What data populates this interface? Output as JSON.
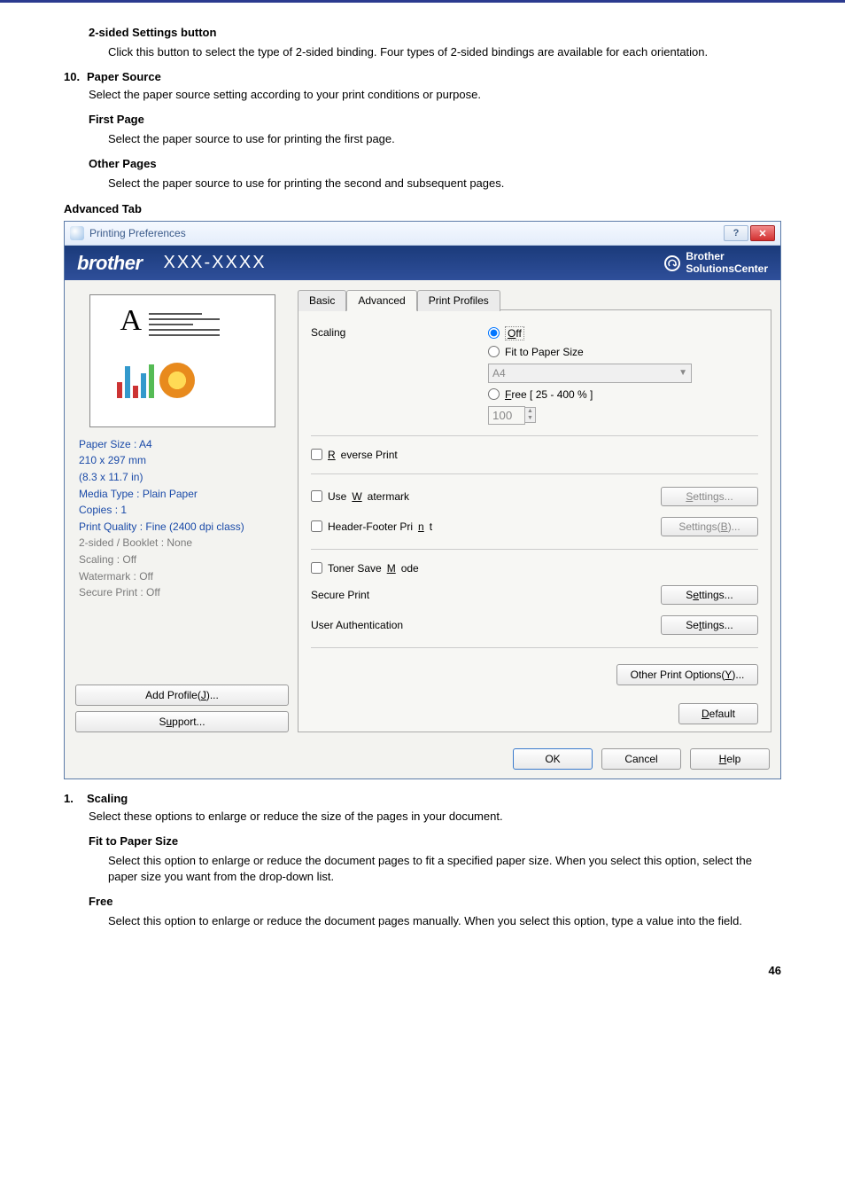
{
  "doc": {
    "two_sided": {
      "title": "2-sided Settings button",
      "body": "Click this button to select the type of 2-sided binding. Four types of 2-sided bindings are available for each orientation."
    },
    "item10": {
      "num": "10.",
      "title": "Paper Source",
      "body": "Select the paper source setting according to your print conditions or purpose.",
      "first_page": {
        "title": "First Page",
        "body": "Select the paper source to use for printing the first page."
      },
      "other_pages": {
        "title": "Other Pages",
        "body": "Select the paper source to use for printing the second and subsequent pages."
      }
    },
    "advanced_tab_label": "Advanced Tab",
    "item1": {
      "num": "1.",
      "title": "Scaling",
      "body": "Select these options to enlarge or reduce the size of the pages in your document.",
      "fit": {
        "title": "Fit to Paper Size",
        "body": "Select this option to enlarge or reduce the document pages to fit a specified paper size. When you select this option, select the paper size you want from the drop-down list."
      },
      "free": {
        "title": "Free",
        "body": "Select this option to enlarge or reduce the document pages manually. When you select this option, type a value into the field."
      }
    },
    "page_number": "46"
  },
  "dialog": {
    "title": "Printing Preferences",
    "brand_logo": "brother",
    "model": "XXX-XXXX",
    "solutions_line1": "Brother",
    "solutions_line2": "SolutionsCenter",
    "summary": {
      "l1": "Paper Size : A4",
      "l2": "210 x 297 mm",
      "l3": "(8.3 x 11.7 in)",
      "l4": "Media Type : Plain Paper",
      "l5": "Copies : 1",
      "l6": "Print Quality : Fine (2400 dpi class)",
      "l7": "2-sided / Booklet : None",
      "l8": "Scaling : Off",
      "l9": "Watermark : Off",
      "l10": "Secure Print : Off"
    },
    "buttons": {
      "add_profile": "Add Profile(J)...",
      "support": "Support...",
      "ok": "OK",
      "cancel": "Cancel",
      "help": "Help",
      "default": "Default"
    },
    "tabs": {
      "basic": "Basic",
      "advanced": "Advanced",
      "profiles": "Print Profiles"
    },
    "scaling": {
      "label": "Scaling",
      "off": "Off",
      "fit": "Fit to Paper Size",
      "fit_value": "A4",
      "free": "Free [ 25 - 400 % ]",
      "free_value": "100"
    },
    "options": {
      "reverse": "Reverse Print",
      "watermark": "Use Watermark",
      "header_footer": "Header-Footer Print",
      "toner_save": "Toner Save Mode",
      "secure_print": "Secure Print",
      "user_auth": "User Authentication",
      "settings": "Settings...",
      "settings_b": "Settings(B)...",
      "other_options": "Other Print Options(Y)..."
    }
  }
}
